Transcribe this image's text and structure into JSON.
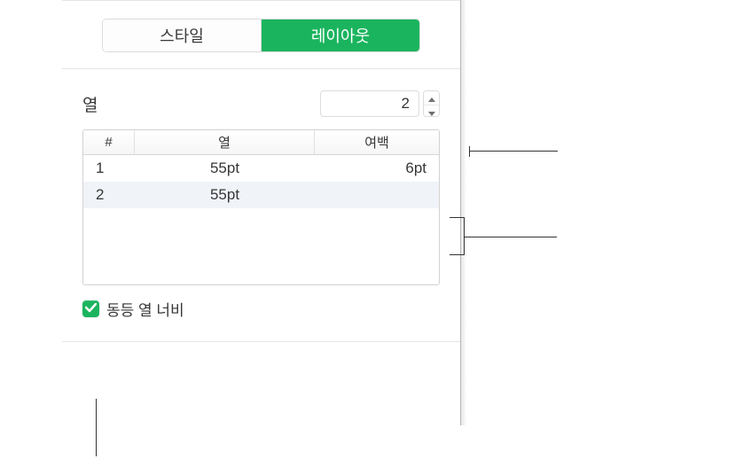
{
  "tabs": {
    "style": "스타일",
    "layout": "레이아웃"
  },
  "columns": {
    "label": "열",
    "count": "2",
    "headers": {
      "index": "#",
      "width": "열",
      "gutter": "여백"
    },
    "rows": [
      {
        "index": "1",
        "width": "55pt",
        "gutter": "6pt"
      },
      {
        "index": "2",
        "width": "55pt",
        "gutter": ""
      }
    ]
  },
  "equalWidth": {
    "checked": true,
    "label": "동등 열 너비"
  }
}
